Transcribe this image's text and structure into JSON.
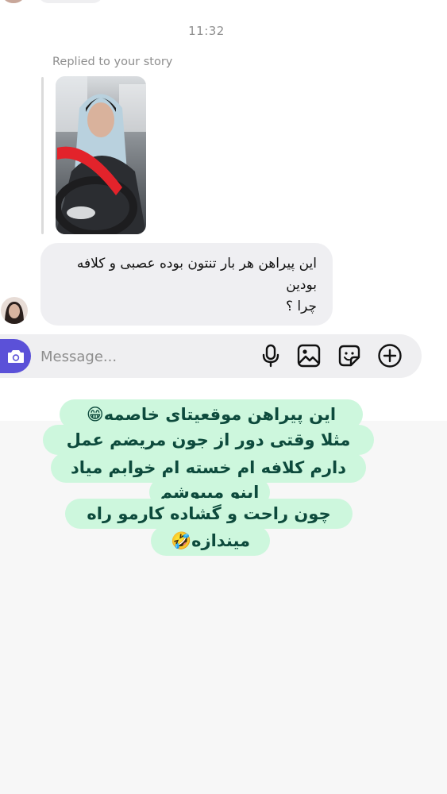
{
  "chat": {
    "timestamp": "11:32",
    "replied_label": "Replied to your story",
    "message_lines": [
      "این پیراهن هر بار تنتون بوده عصبی و کلافه",
      "بودین",
      "چرا ؟"
    ]
  },
  "composer": {
    "placeholder": "Message...",
    "icons": [
      "camera-icon",
      "microphone-icon",
      "gallery-icon",
      "sticker-icon",
      "add-icon"
    ]
  },
  "overlay_reply": {
    "lines": [
      "این پیراهن موقعیتای خاصمه😁",
      "مثلا وقتی دور از جون مریضم عمل",
      "دارم کلافه ام خسته ام خوابم میاد",
      "اینو میپوشم",
      "چون راحت و گشاده کارمو راه",
      "میندازه🤣"
    ],
    "background_color": "#cdf7dd",
    "text_color": "#0d4a3c"
  }
}
